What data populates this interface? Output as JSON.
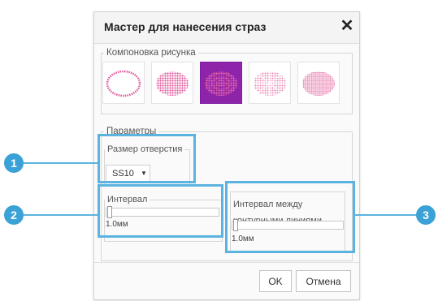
{
  "dialog": {
    "title": "Мастер для нанесения страз",
    "close_symbol": "✕"
  },
  "layout": {
    "legend": "Компоновка рисунка",
    "tiles": [
      {
        "name": "outline-ellipse-pattern-icon",
        "selected": false
      },
      {
        "name": "filled-grid-pattern-icon",
        "selected": false
      },
      {
        "name": "concentric-rings-pattern-icon",
        "selected": true
      },
      {
        "name": "radial-pattern-icon",
        "selected": false
      },
      {
        "name": "dense-grid-pattern-icon",
        "selected": false
      }
    ],
    "accent_color": "#8e24aa",
    "dot_color": "#e0559a"
  },
  "params": {
    "legend": "Параметры",
    "hole_size": {
      "legend": "Размер отверстия",
      "value": "SS10",
      "caret": "▼"
    },
    "interval": {
      "legend": "Интервал",
      "value": "1.0мм",
      "level": 0
    },
    "contour_interval": {
      "label": "Интервал между контурными линиями",
      "value": "1.0мм",
      "level": 0
    }
  },
  "buttons": {
    "ok": "OK",
    "cancel": "Отмена"
  },
  "callouts": [
    "1",
    "2",
    "3"
  ],
  "highlight_color": "#5bb3e0"
}
